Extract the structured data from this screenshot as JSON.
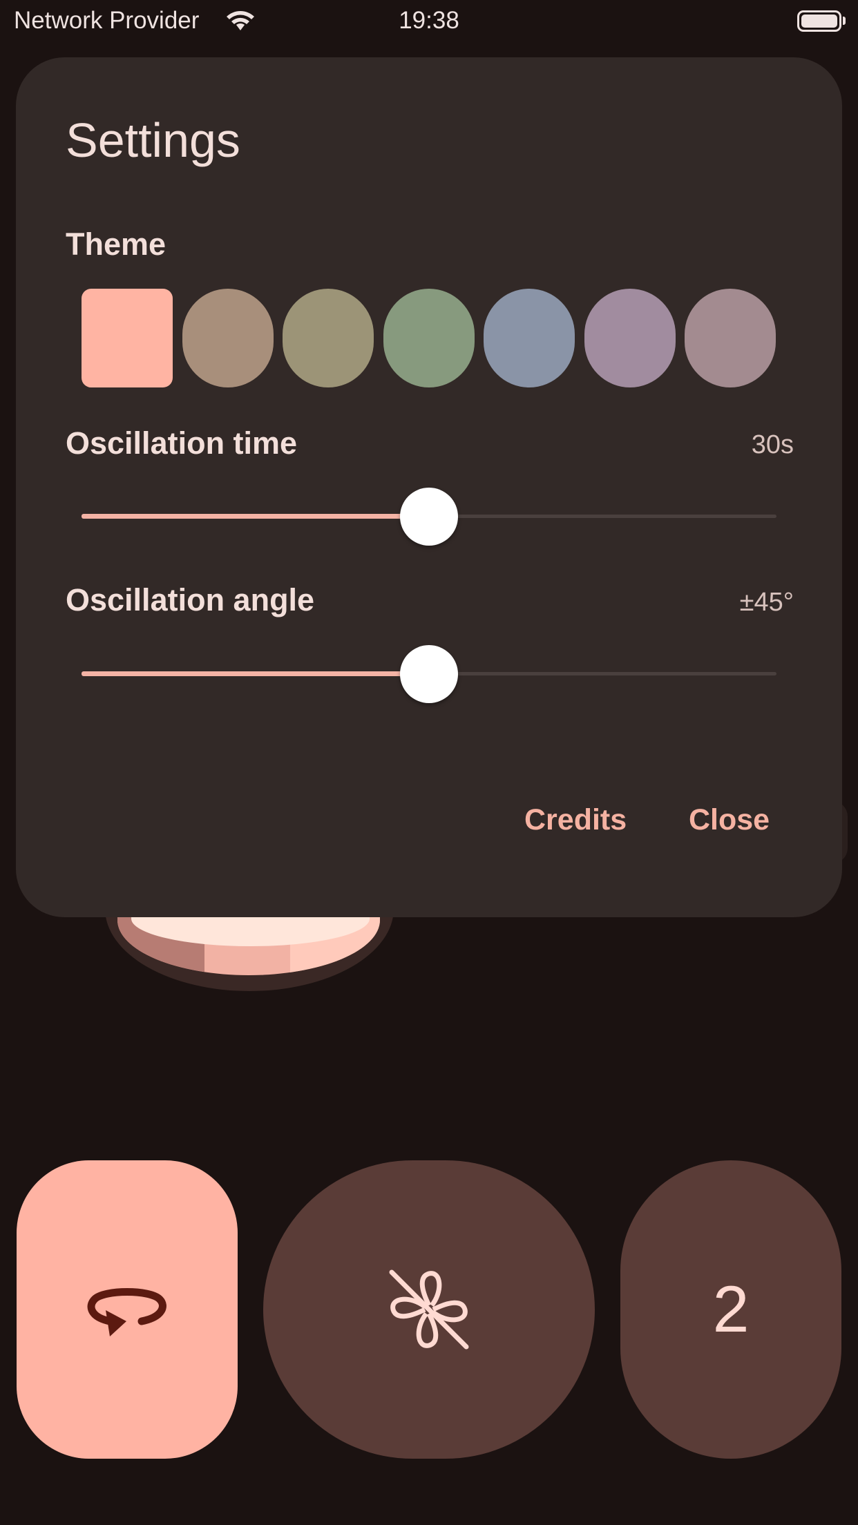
{
  "status_bar": {
    "carrier": "Network Provider",
    "time": "19:38"
  },
  "dialog": {
    "title": "Settings",
    "theme": {
      "label": "Theme",
      "selected_index": 0,
      "colors": [
        "#ffb4a3",
        "#a88f7b",
        "#9c9477",
        "#879a7e",
        "#8a94a7",
        "#a18c9f",
        "#a38b90"
      ]
    },
    "oscillation_time": {
      "label": "Oscillation time",
      "value": "30s",
      "fraction": 0.5
    },
    "oscillation_angle": {
      "label": "Oscillation angle",
      "value": "±45°",
      "fraction": 0.5
    },
    "actions": {
      "credits": "Credits",
      "close": "Close"
    }
  },
  "controls": {
    "rotate_icon": "rotate-icon",
    "fan_icon": "fan-off-icon",
    "speed": "2"
  },
  "colors": {
    "accent": "#ffb3a3",
    "background": "#1b1211",
    "dialog": "#322927",
    "button_dark": "#5a3c37"
  }
}
